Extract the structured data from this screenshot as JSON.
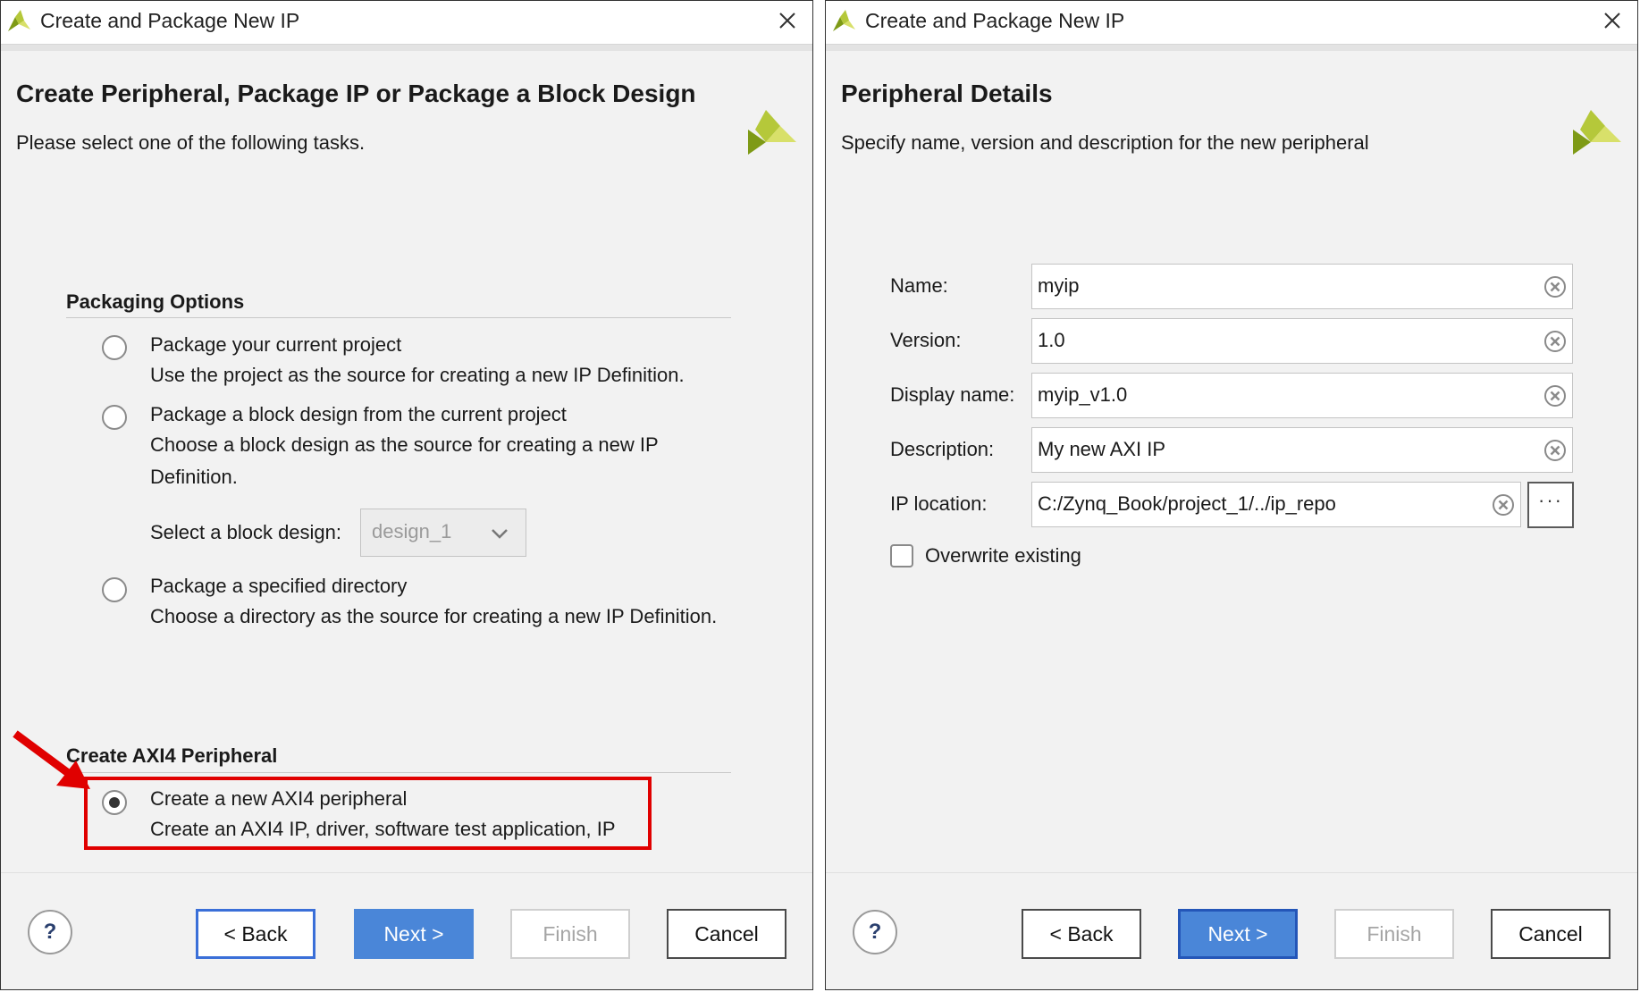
{
  "left_dialog": {
    "window_title": "Create and Package New IP",
    "page_title": "Create Peripheral, Package IP or Package a Block Design",
    "page_subtitle": "Please select one of the following tasks.",
    "packaging_section": "Packaging Options",
    "options": [
      {
        "label": "Package your current project",
        "desc": "Use the project as the source for creating a new IP Definition.",
        "selected": false
      },
      {
        "label": "Package a block design from the current project",
        "desc": "Choose a block design as the source for creating a new IP Definition.",
        "selected": false
      },
      {
        "label": "Package a specified directory",
        "desc": "Choose a directory as the source for creating a new IP Definition.",
        "selected": false
      }
    ],
    "block_design_label": "Select a block design:",
    "block_design_value": "design_1",
    "axi_section": "Create AXI4 Peripheral",
    "axi_option": {
      "label": "Create a new AXI4 peripheral",
      "desc": "Create an AXI4 IP, driver, software test application, IP",
      "selected": true
    },
    "buttons": {
      "help": "?",
      "back": "< Back",
      "next": "Next >",
      "finish": "Finish",
      "cancel": "Cancel"
    }
  },
  "right_dialog": {
    "window_title": "Create and Package New IP",
    "page_title": "Peripheral Details",
    "page_subtitle": "Specify name, version and description for the new peripheral",
    "fields": [
      {
        "label": "Name:",
        "value": "myip"
      },
      {
        "label": "Version:",
        "value": "1.0"
      },
      {
        "label": "Display name:",
        "value": "myip_v1.0"
      },
      {
        "label": "Description:",
        "value": "My new AXI IP"
      },
      {
        "label": "IP location:",
        "value": "C:/Zynq_Book/project_1/../ip_repo"
      }
    ],
    "browse_label": "···",
    "overwrite_label": "Overwrite existing",
    "overwrite_checked": false,
    "buttons": {
      "help": "?",
      "back": "< Back",
      "next": "Next >",
      "finish": "Finish",
      "cancel": "Cancel"
    }
  },
  "colors": {
    "primary_button": "#4a86d8",
    "highlight_box": "#e00000",
    "brand_green": "#b5c83a"
  }
}
